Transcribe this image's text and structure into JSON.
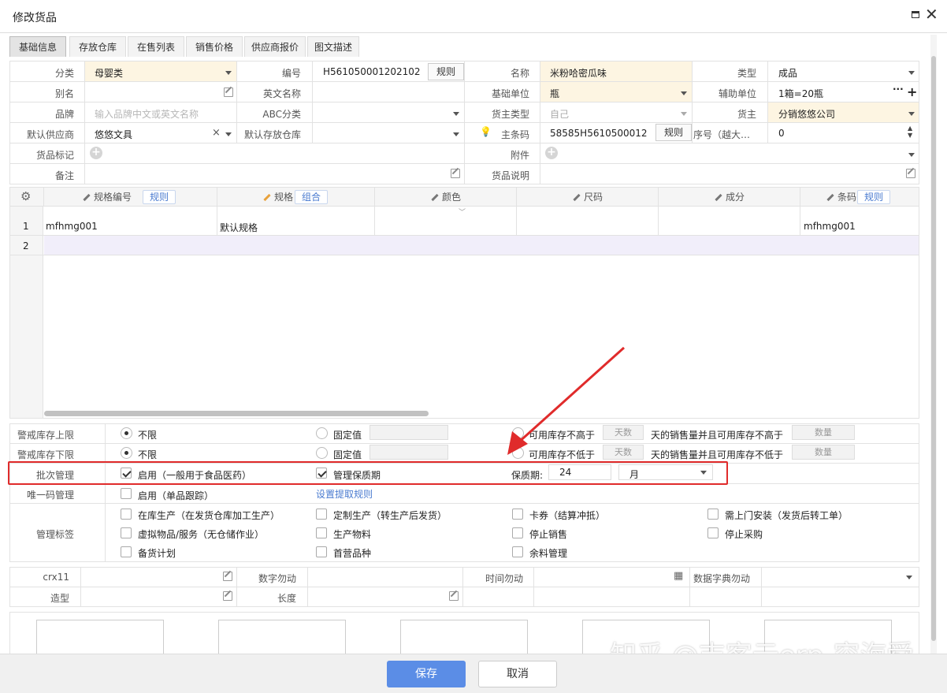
{
  "window": {
    "title": "修改货品"
  },
  "tabs": [
    "基础信息",
    "存放仓库",
    "在售列表",
    "销售价格",
    "供应商报价",
    "图文描述"
  ],
  "form": {
    "category_label": "分类",
    "category_value": "母婴类",
    "code_label": "编号",
    "code_value": "H561050001202102",
    "code_rule": "规则",
    "name_label": "名称",
    "name_value": "米粉哈密瓜味",
    "type_label": "类型",
    "type_value": "成品",
    "alias_label": "别名",
    "en_name_label": "英文名称",
    "base_unit_label": "基础单位",
    "base_unit_value": "瓶",
    "aux_unit_label": "辅助单位",
    "aux_unit_value": "1箱=20瓶",
    "brand_label": "品牌",
    "brand_placeholder": "输入品牌中文或英文名称",
    "abc_label": "ABC分类",
    "owner_type_label": "货主类型",
    "owner_type_value": "自己",
    "owner_label": "货主",
    "owner_value": "分销悠悠公司",
    "supplier_label": "默认供应商",
    "supplier_value": "悠悠文具",
    "warehouse_label": "默认存放仓库",
    "barcode_label": "主条码",
    "barcode_value": "58585H5610500012",
    "barcode_rule": "规则",
    "seq_label": "序号（越大…",
    "seq_value": "0",
    "tag_label": "货品标记",
    "attach_label": "附件",
    "remark_label": "备注",
    "desc_label": "货品说明"
  },
  "spec_table": {
    "headers": [
      "规格编号",
      "规格",
      "颜色",
      "尺码",
      "成分",
      "条码"
    ],
    "rule_btn": "规则",
    "combo_btn": "组合",
    "barcode_rule_btn": "规则",
    "rows": [
      {
        "no": "1",
        "code": "mfhmg001",
        "spec": "默认规格",
        "barcode": "mfhmg001"
      },
      {
        "no": "2",
        "code": "",
        "spec": "",
        "barcode": ""
      }
    ]
  },
  "stock": {
    "upper_label": "警戒库存上限",
    "lower_label": "警戒库存下限",
    "unlimited": "不限",
    "fixed": "固定值",
    "avail_not_above": "可用库存不高于",
    "avail_not_below": "可用库存不低于",
    "days_ph": "天数",
    "days_sales_above": "天的销售量并且可用库存不高于",
    "days_sales_below": "天的销售量并且可用库存不低于",
    "qty_ph": "数量"
  },
  "batch": {
    "label": "批次管理",
    "enable": "启用（一般用于食品医药）",
    "shelf_manage": "管理保质期",
    "shelf_label": "保质期:",
    "shelf_value": "24",
    "shelf_unit": "月"
  },
  "unique": {
    "label": "唯一码管理",
    "enable": "启用（单品跟踪）",
    "link": "设置提取规则"
  },
  "tags": {
    "label": "管理标签",
    "items": [
      "在库生产（在发货仓库加工生产）",
      "定制生产（转生产后发货）",
      "卡券（结算冲抵）",
      "需上门安装（发货后转工单）",
      "虚拟物品/服务（无仓储作业）",
      "生产物料",
      "停止销售",
      "停止采购",
      "备货计划",
      "首营品种",
      "余料管理"
    ]
  },
  "custom": {
    "crx11": "crx11",
    "num_dont": "数字勿动",
    "time_dont": "时间勿动",
    "dict_dont": "数据字典勿动",
    "shape": "造型",
    "length": "长度"
  },
  "footer": {
    "save": "保存",
    "cancel": "取消"
  },
  "watermark": "知乎 @吉客云erp-容海舜",
  "colors": {
    "primary": "#5b8de6",
    "highlight": "#fdf5e2",
    "annotation": "#e02b2b"
  }
}
